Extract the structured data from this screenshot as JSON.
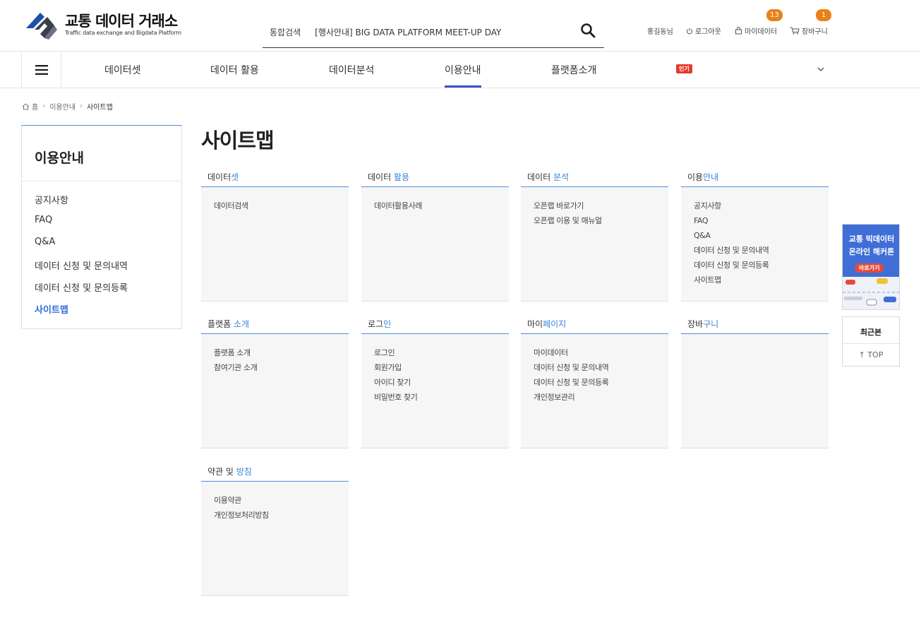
{
  "header": {
    "logo_title": "교통 데이터 거래소",
    "logo_subtitle": "Traffic data exchange and Bigdata Platform",
    "search_label": "통합검색",
    "search_value": "[행사안내] BIG DATA PLATFORM MEET-UP DAY",
    "user": "홍길동님",
    "logout": "로그아웃",
    "mydata": "마이데이터",
    "mydata_count": "13",
    "cart": "장바구니",
    "cart_count": "1"
  },
  "nav": {
    "items": [
      "데이터셋",
      "데이터 활용",
      "데이터분석",
      "이용안내",
      "플랫폼소개"
    ],
    "active": "이용안내",
    "hot_badge": "인기"
  },
  "breadcrumb": [
    "홈",
    "이용안내",
    "사이트맵"
  ],
  "sidebar": {
    "title": "이용안내",
    "items": [
      "공지사항",
      "FAQ",
      "Q&A",
      "데이터 신청 및 문의내역",
      "데이터 신청 및 문의등록",
      "사이트맵"
    ],
    "active_index": 5
  },
  "main": {
    "title": "사이트맵",
    "sections": [
      {
        "head_plain": "데이터",
        "head_hl": "셋",
        "links": [
          "데이터검색"
        ]
      },
      {
        "head_plain": "데이터 ",
        "head_hl": "활용",
        "links": [
          "데이터활용사례"
        ]
      },
      {
        "head_plain": "데이터 ",
        "head_hl": "분석",
        "links": [
          "오픈랩 바로가기",
          "오픈랩 이용 및 매뉴얼"
        ]
      },
      {
        "head_plain": "이용",
        "head_hl": "안내",
        "links": [
          "공지사항",
          "FAQ",
          "Q&A",
          "데이터 신청 및 문의내역",
          "데이터 신청 및 문의등록",
          "사이트맵"
        ]
      },
      {
        "head_plain": "플랫폼 ",
        "head_hl": "소개",
        "links": [
          "플랫폼 소개",
          "참여기관 소개"
        ]
      },
      {
        "head_plain": "로그",
        "head_hl": "인",
        "links": [
          "로그인",
          "회원가입",
          "아이디 찾기",
          "비밀번호 찾기"
        ]
      },
      {
        "head_plain": "마이",
        "head_hl": "페이지",
        "links": [
          "마이데이터",
          "데이터 신청 및 문의내역",
          "데이터 신청 및 문의등록",
          "개인정보관리"
        ]
      },
      {
        "head_plain": "장바",
        "head_hl": "구니",
        "links": []
      },
      {
        "head_plain": "약관 및 ",
        "head_hl": "방침",
        "links": [
          "이용약관",
          "개인정보처리방침"
        ]
      }
    ]
  },
  "floating": {
    "banner_line1": "교통 빅데이터",
    "banner_line2": "온라인 해커톤",
    "banner_button": "바로가기",
    "recent": "최근본",
    "top": "↑ TOP"
  },
  "colors": {
    "accent": "#3c4ecb",
    "link_highlight": "#3a84d8",
    "badge": "#e8811a",
    "hot": "#e53a2c"
  }
}
